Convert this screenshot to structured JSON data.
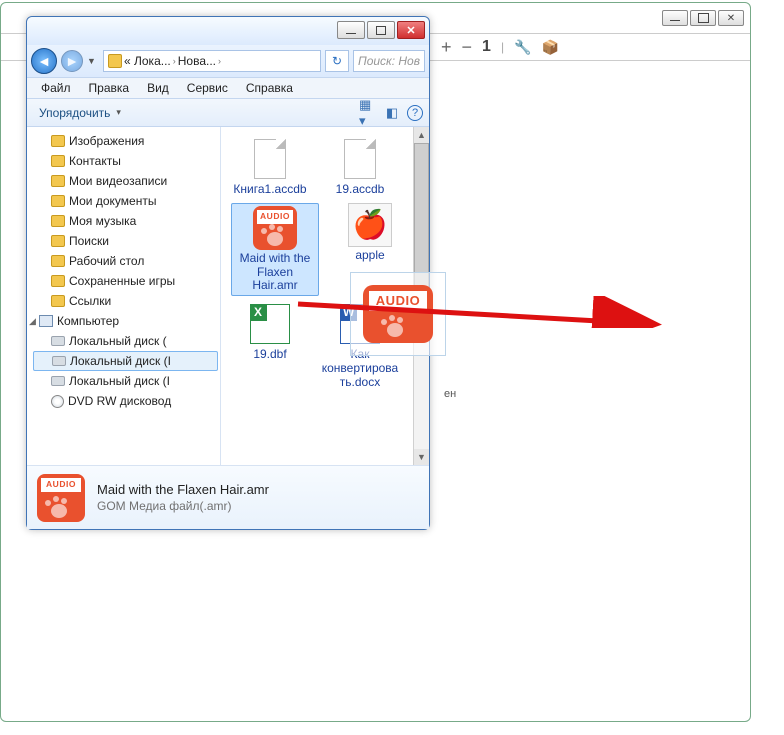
{
  "bg_window": {
    "toolbar": {
      "plus": "+",
      "minus": "−",
      "one": "1",
      "wrench": "🔧",
      "box": "📦"
    },
    "drop_hint": "ен"
  },
  "explorer": {
    "breadcrumb": {
      "seg1": "« Лока...",
      "seg2": "Нова...",
      "sep": "›"
    },
    "search_placeholder": "Поиск: Нов",
    "refresh": "↻",
    "menu": {
      "file": "Файл",
      "edit": "Правка",
      "view": "Вид",
      "service": "Сервис",
      "help": "Справка"
    },
    "tool": {
      "organize": "Упорядочить"
    },
    "tree": [
      {
        "label": "Изображения",
        "icon": "folder"
      },
      {
        "label": "Контакты",
        "icon": "folder"
      },
      {
        "label": "Мои видеозаписи",
        "icon": "folder"
      },
      {
        "label": "Мои документы",
        "icon": "folder"
      },
      {
        "label": "Моя музыка",
        "icon": "folder"
      },
      {
        "label": "Поиски",
        "icon": "folder"
      },
      {
        "label": "Рабочий стол",
        "icon": "folder"
      },
      {
        "label": "Сохраненные игры",
        "icon": "folder"
      },
      {
        "label": "Ссылки",
        "icon": "folder"
      },
      {
        "label": "Компьютер",
        "icon": "computer"
      },
      {
        "label": "Локальный диск (",
        "icon": "drive"
      },
      {
        "label": "Локальный диск (I",
        "icon": "drive",
        "selected": true
      },
      {
        "label": "Локальный диск (I",
        "icon": "drive"
      },
      {
        "label": "DVD RW дисковод",
        "icon": "dvd"
      }
    ],
    "files": [
      {
        "label": "Книга1.accdb",
        "icon": "plain"
      },
      {
        "label": "19.accdb",
        "icon": "plain"
      },
      {
        "label": "Maid with the Flaxen Hair.amr",
        "icon": "audio",
        "selected": true
      },
      {
        "label": "apple",
        "icon": "image"
      },
      {
        "label": "19.dbf",
        "icon": "xls"
      },
      {
        "label": "Как конвертировать.docx",
        "icon": "doc"
      }
    ],
    "details": {
      "filename": "Maid with the Flaxen Hair.amr",
      "filetype": "GOM Медиа файл(.amr)"
    }
  }
}
